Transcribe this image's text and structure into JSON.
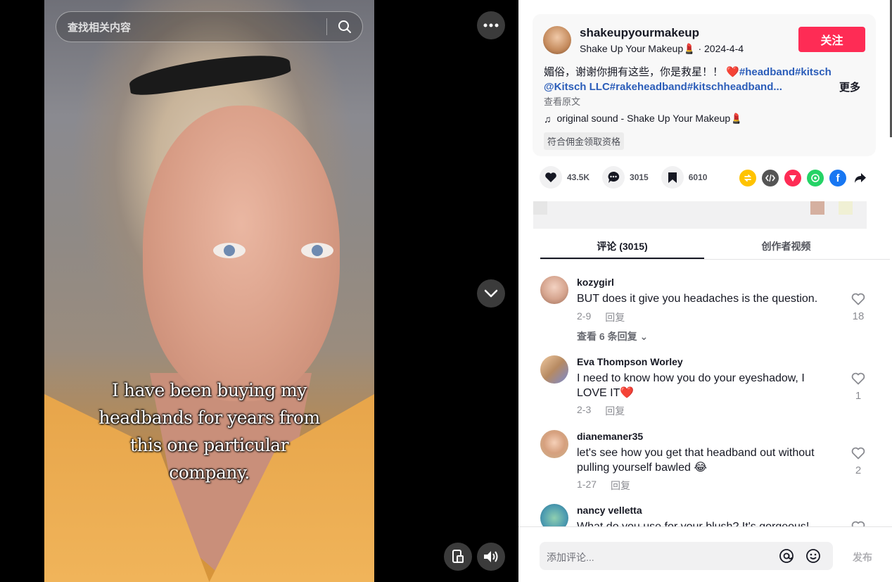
{
  "search": {
    "placeholder": "查找相关内容"
  },
  "video": {
    "caption": [
      "I have been buying my",
      "headbands for years from",
      "this one particular",
      "company."
    ]
  },
  "post": {
    "author_handle": "shakeupyourmakeup",
    "author_name": "Shake Up Your Makeup💄",
    "date_sep": "·",
    "date": "2024-4-4",
    "follow_label": "关注",
    "description_text": "媚俗，谢谢你拥有这些，你是救星！！ ❤️",
    "description_tags": "#headband#kitsch @Kitsch LLC#rakeheadband#kitschheadband...",
    "more_label": "更多",
    "view_original": "查看原文",
    "music": "original sound - Shake Up Your Makeup💄",
    "eligible_label": "符合佣金领取资格"
  },
  "actions": {
    "likes": "43.5K",
    "comments": "3015",
    "saves": "6010"
  },
  "tabs": [
    {
      "label": "评论 (3015)"
    },
    {
      "label": "创作者视频"
    }
  ],
  "comments": [
    {
      "user": "kozygirl",
      "text": "BUT does it give you headaches is the question.",
      "date": "2-9",
      "reply": "回复",
      "likes": "18",
      "view_replies": "查看 6 条回复 ⌄"
    },
    {
      "user": "Eva Thompson Worley",
      "text": "I need to know how you do your eyeshadow, I LOVE IT❤️",
      "date": "2-3",
      "reply": "回复",
      "likes": "1"
    },
    {
      "user": "dianemaner35",
      "text": "let's see how you get that headband out without pulling yourself bawled 😂",
      "date": "1-27",
      "reply": "回复",
      "likes": "2"
    },
    {
      "user": "nancy velletta",
      "text": "What do you use for your blush? It's gorgeous!",
      "likes": ""
    }
  ],
  "composer": {
    "placeholder": "添加评论...",
    "post_label": "发布"
  },
  "colors": {
    "accent": "#fe2c55",
    "link": "#2b5db9"
  },
  "icons": [
    "search-icon",
    "more-icon",
    "chevron-down-icon",
    "device-icon",
    "volume-icon",
    "heart-icon",
    "comment-icon",
    "bookmark-icon",
    "repost-icon",
    "embed-icon",
    "send-icon",
    "whatsapp-icon",
    "facebook-icon",
    "share-icon",
    "music-icon",
    "at-icon",
    "emoji-icon"
  ]
}
